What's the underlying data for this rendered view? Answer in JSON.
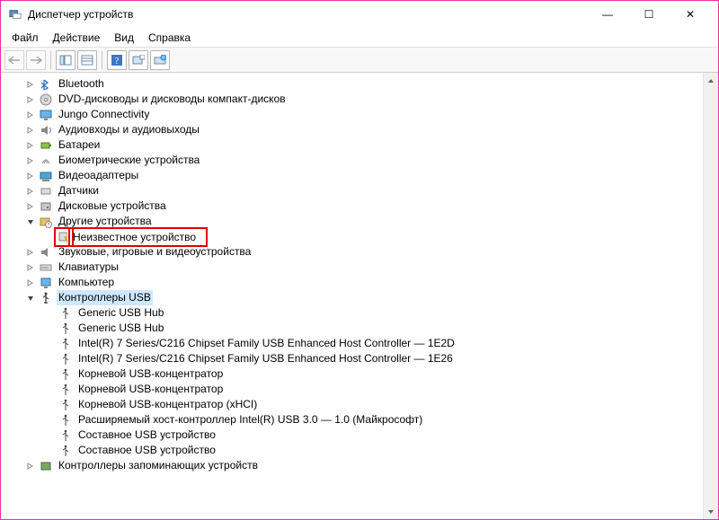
{
  "window": {
    "title": "Диспетчер устройств",
    "minimize": "—",
    "maximize": "☐",
    "close": "✕"
  },
  "menu": {
    "file": "Файл",
    "action": "Действие",
    "view": "Вид",
    "help": "Справка"
  },
  "tree": {
    "bluetooth": "Bluetooth",
    "dvd": "DVD-дисководы и дисководы компакт-дисков",
    "jungo": "Jungo Connectivity",
    "audio": "Аудиовходы и аудиовыходы",
    "battery": "Батареи",
    "biometric": "Биометрические устройства",
    "video": "Видеоадаптеры",
    "sensors": "Датчики",
    "disk": "Дисковые устройства",
    "other": "Другие устройства",
    "unknown": "Неизвестное устройство",
    "sound": "Звуковые, игровые и видеоустройства",
    "keyboard": "Клавиатуры",
    "computer": "Компьютер",
    "usb": "Контроллеры USB",
    "usb_items": [
      "Generic USB Hub",
      "Generic USB Hub",
      "Intel(R) 7 Series/C216 Chipset Family USB Enhanced Host Controller — 1E2D",
      "Intel(R) 7 Series/C216 Chipset Family USB Enhanced Host Controller — 1E26",
      "Корневой USB-концентратор",
      "Корневой USB-концентратор",
      "Корневой USB-концентратор (xHCI)",
      "Расширяемый хост-контроллер Intel(R) USB 3.0 — 1.0 (Майкрософт)",
      "Составное USB устройство",
      "Составное USB устройство"
    ],
    "storage": "Контроллеры запоминающих устройств"
  }
}
